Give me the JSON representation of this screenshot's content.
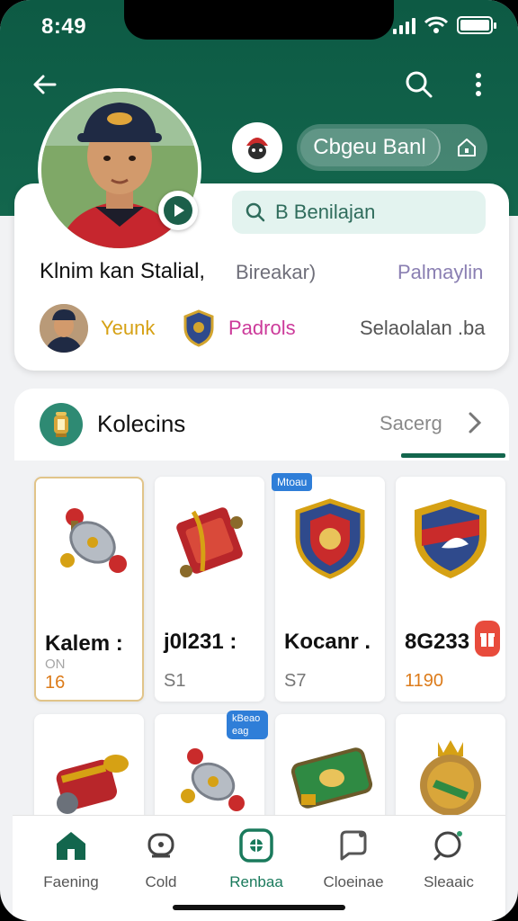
{
  "status": {
    "time": "8:49"
  },
  "header": {
    "pill_label": "Cbgeu Banl"
  },
  "profile": {
    "search_placeholder": "B Benilajan",
    "name": "Klnim kan Stalial,",
    "role": "Bireakar)",
    "meta": "Palmaylin",
    "level": "Yeunk",
    "badge": "Padrols",
    "selection": "Selaolalan .ba"
  },
  "collections": {
    "title": "Kolecins",
    "link": "Sacerg"
  },
  "items": [
    {
      "name": "Kalem :",
      "sub": "ON",
      "price": "16",
      "price_color": "#dc7b1a",
      "tag": ""
    },
    {
      "name": "j0l231 :",
      "sub": "",
      "price": "S1",
      "price_color": "#777777",
      "tag": ""
    },
    {
      "name": "Kocanr .",
      "sub": "",
      "price": "S7",
      "price_color": "#777777",
      "tag": "Mtoau"
    },
    {
      "name": "8G233",
      "sub": "",
      "price": "1190",
      "price_color": "#dc7b1a",
      "tag": ""
    },
    {
      "name": "",
      "sub": "",
      "price": "",
      "tag": ""
    },
    {
      "name": "",
      "sub": "",
      "price": "",
      "tag": "kBeao eag"
    },
    {
      "name": "",
      "sub": "",
      "price": "",
      "tag": ""
    },
    {
      "name": "",
      "sub": "",
      "price": "",
      "tag": ""
    }
  ],
  "nav": [
    {
      "label": "Faening",
      "icon": "home-icon"
    },
    {
      "label": "Cold",
      "icon": "controller-icon"
    },
    {
      "label": "Renbaa",
      "icon": "store-icon"
    },
    {
      "label": "Cloeinae",
      "icon": "chat-icon"
    },
    {
      "label": "Sleaaic",
      "icon": "search-icon"
    }
  ],
  "colors": {
    "header_green": "#13664d",
    "accent_green": "#1a7a5c",
    "search_bg": "#e3f3ef",
    "level_gold": "#d6a114",
    "badge_pink": "#cc3a9a"
  }
}
